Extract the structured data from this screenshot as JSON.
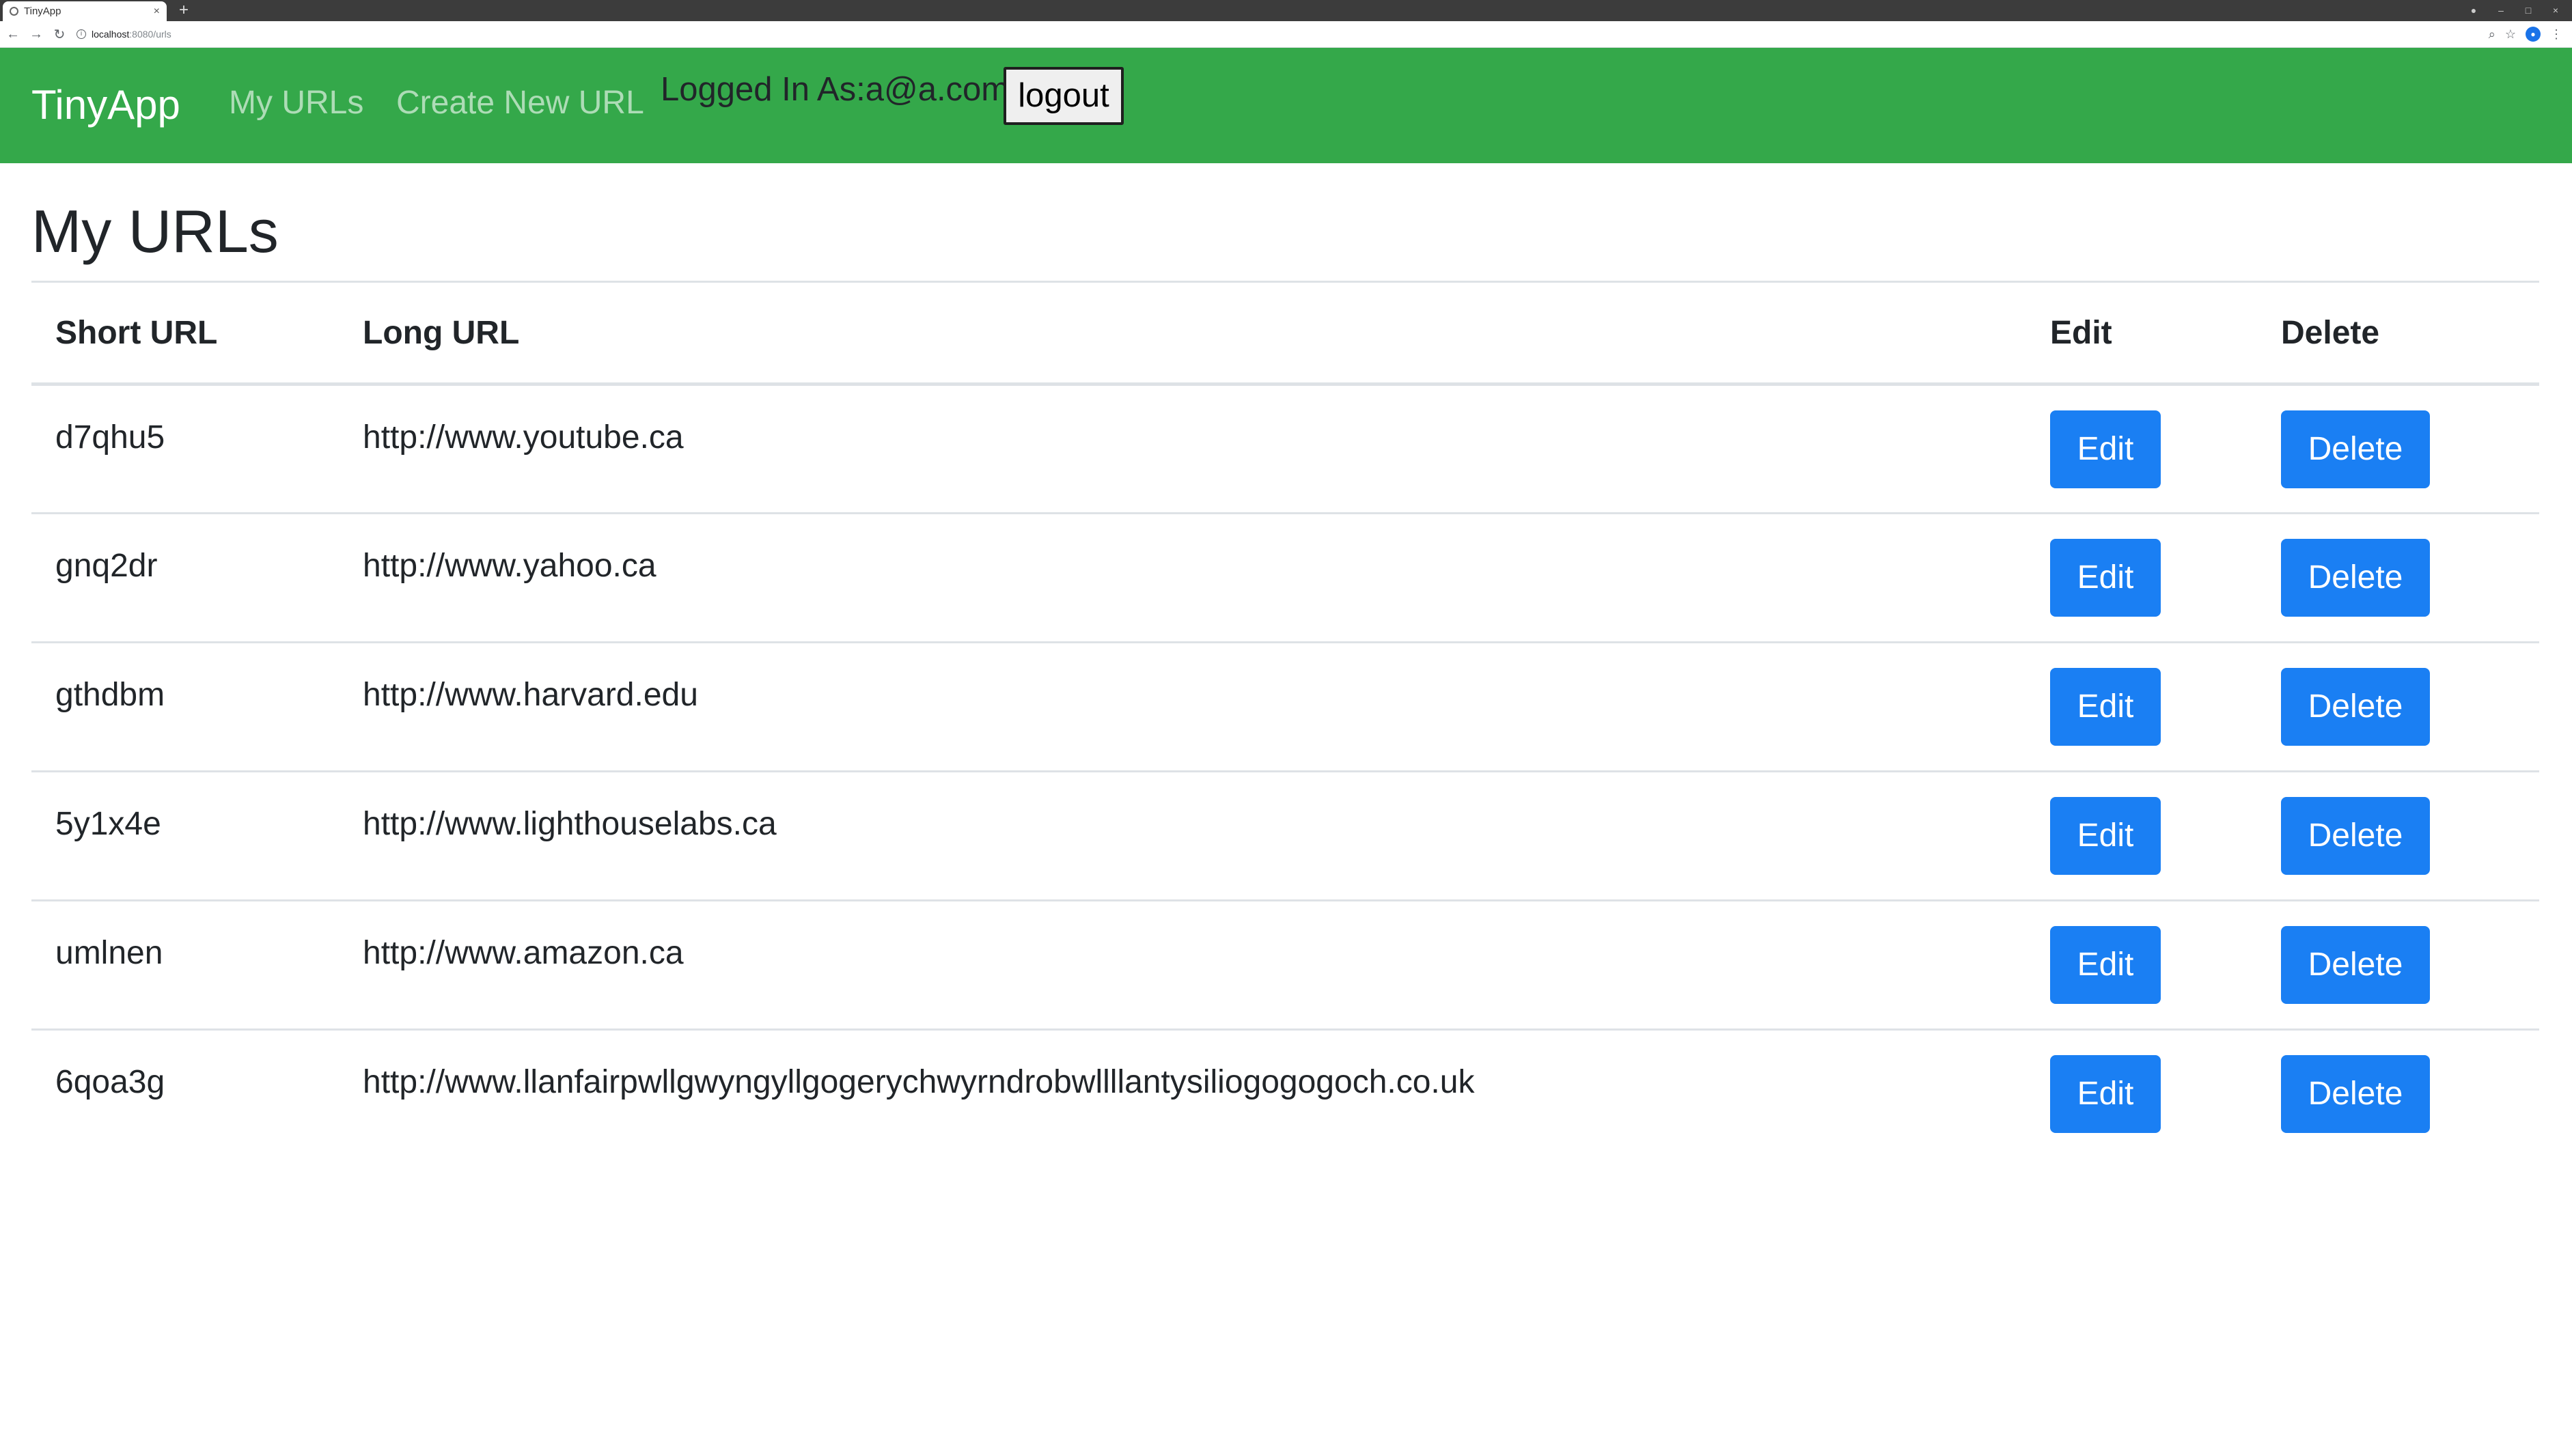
{
  "browser": {
    "tab_title": "TinyApp",
    "url_host": "localhost",
    "url_rest": ":8080/urls"
  },
  "navbar": {
    "brand": "TinyApp",
    "links": [
      "My URLs",
      "Create New URL"
    ],
    "login_text": "Logged In As:a@a.com",
    "logout_label": "logout",
    "color": "#34a84a"
  },
  "main": {
    "title": "My URLs",
    "columns": [
      "Short URL",
      "Long URL",
      "Edit",
      "Delete"
    ],
    "rows": [
      {
        "short": "d7qhu5",
        "long": "http://www.youtube.ca",
        "edit": "Edit",
        "delete": "Delete"
      },
      {
        "short": "gnq2dr",
        "long": "http://www.yahoo.ca",
        "edit": "Edit",
        "delete": "Delete"
      },
      {
        "short": "gthdbm",
        "long": "http://www.harvard.edu",
        "edit": "Edit",
        "delete": "Delete"
      },
      {
        "short": "5y1x4e",
        "long": "http://www.lighthouselabs.ca",
        "edit": "Edit",
        "delete": "Delete"
      },
      {
        "short": "umlnen",
        "long": "http://www.amazon.ca",
        "edit": "Edit",
        "delete": "Delete"
      },
      {
        "short": "6qoa3g",
        "long": "http://www.llanfairpwllgwyngyllgogerychwyrndrobwllllantysiliogogogoch.co.uk",
        "edit": "Edit",
        "delete": "Delete"
      }
    ],
    "button_color": "#1a7ff3"
  }
}
